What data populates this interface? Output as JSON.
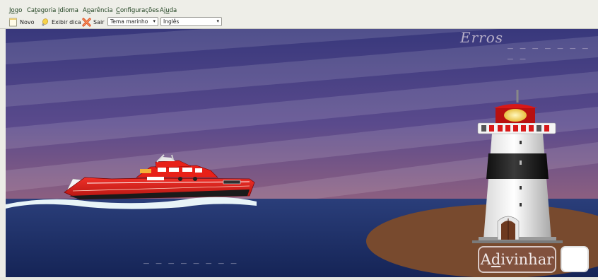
{
  "menu": {
    "items": [
      {
        "before": "J",
        "ul": "o",
        "after": "go"
      },
      {
        "before": "Ca",
        "ul": "t",
        "after": "egoria"
      },
      {
        "before": "",
        "ul": "I",
        "after": "dioma"
      },
      {
        "before": "A",
        "ul": "p",
        "after": "arência"
      },
      {
        "before": "",
        "ul": "C",
        "after": "onfigurações"
      },
      {
        "before": "Aj",
        "ul": "u",
        "after": "da"
      }
    ]
  },
  "toolbar": {
    "new_label": "Novo",
    "hint_label": "Exibir dica",
    "quit_label": "Sair",
    "theme_select": "Tema marinho",
    "language_select": "Inglês"
  },
  "game": {
    "errors_label": "Erros",
    "errors_slots": "_ _ _ _ _ _ _ _ _",
    "word_slots": "_ _ _ _ _ _ _ _",
    "guess_before": "A",
    "guess_ul": "d",
    "guess_after": "ivinhar",
    "letter_value": ""
  },
  "colors": {
    "sky_top": "#3a3a80",
    "sky_bottom": "#8a5a7a",
    "sea": "#1e2e6a",
    "island": "#7a4a30",
    "boat": "#e0201a",
    "lighthouse_red": "#d01818"
  },
  "icons": {
    "new": "new-document-icon",
    "hint": "lightbulb-icon",
    "quit": "quit-icon"
  }
}
